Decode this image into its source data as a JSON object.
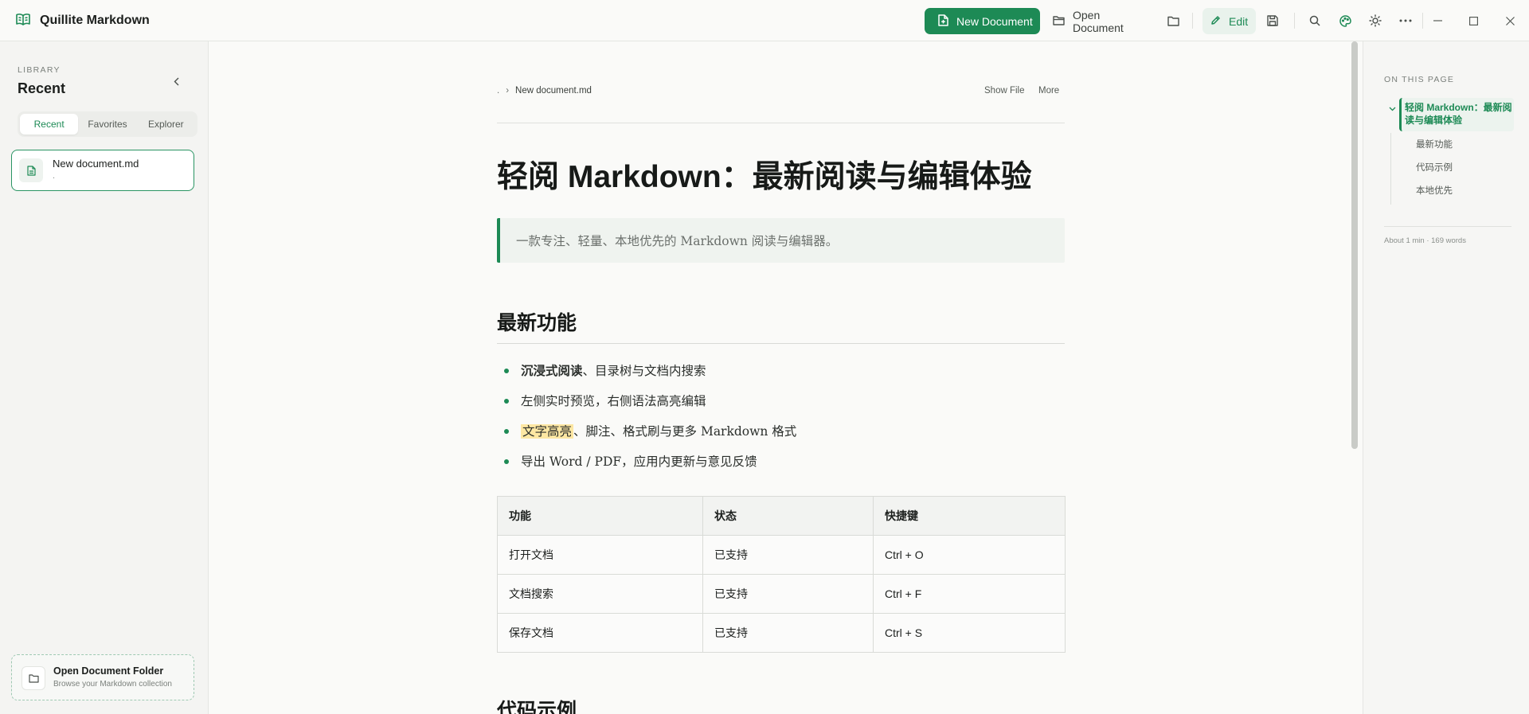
{
  "app": {
    "title": "Quillite Markdown"
  },
  "toolbar": {
    "new_document": "New Document",
    "open_document": "Open Document",
    "edit": "Edit",
    "accent_color": "#1d8a55"
  },
  "sidebar": {
    "section_label": "LIBRARY",
    "title": "Recent",
    "tabs": [
      {
        "label": "Recent",
        "active": true
      },
      {
        "label": "Favorites",
        "active": false
      },
      {
        "label": "Explorer",
        "active": false
      }
    ],
    "documents": [
      {
        "name": "New document.md",
        "path": "."
      }
    ],
    "open_folder": {
      "title": "Open Document Folder",
      "subtitle": "Browse your Markdown collection"
    }
  },
  "document": {
    "breadcrumb_root": ".",
    "breadcrumb_sep": "›",
    "file_name": "New document.md",
    "show_file": "Show File",
    "more": "More",
    "h1": "轻阅 Markdown：最新阅读与编辑体验",
    "blockquote": "一款专注、轻量、本地优先的 Markdown 阅读与编辑器。",
    "section_features": "最新功能",
    "bullets": {
      "b1_bold": "沉浸式阅读",
      "b1_rest": "、目录树与文档内搜索",
      "b2": "左侧实时预览，右侧语法高亮编辑",
      "b3_highlight": "文字高亮",
      "b3_rest": "、脚注、格式刷与更多 Markdown 格式",
      "b4": "导出 Word / PDF，应用内更新与意见反馈"
    },
    "table": {
      "headers": [
        "功能",
        "状态",
        "快捷键"
      ],
      "rows": [
        [
          "打开文档",
          "已支持",
          "Ctrl + O"
        ],
        [
          "文档搜索",
          "已支持",
          "Ctrl + F"
        ],
        [
          "保存文档",
          "已支持",
          "Ctrl + S"
        ]
      ]
    },
    "section_code": "代码示例"
  },
  "toc": {
    "label": "ON THIS PAGE",
    "active_line1": "轻阅 Markdown：最新阅",
    "active_line2": "读与编辑体验",
    "items": [
      "最新功能",
      "代码示例",
      "本地优先"
    ],
    "meta": "About 1 min · 169 words"
  }
}
